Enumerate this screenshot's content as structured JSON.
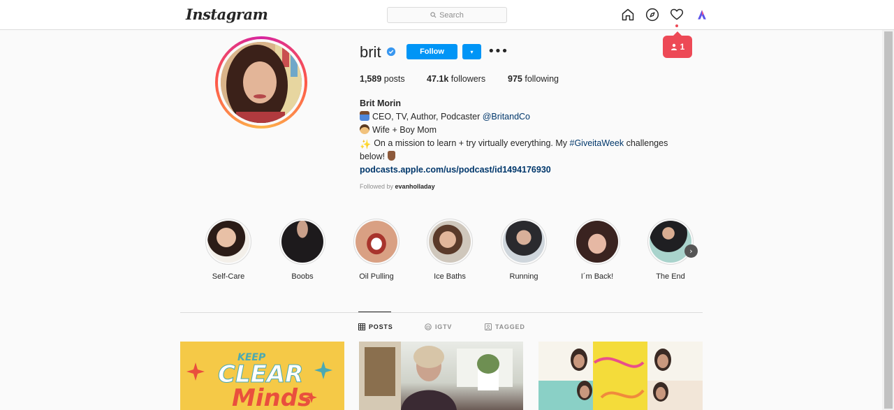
{
  "nav": {
    "logo": "Instagram",
    "search_placeholder": "Search",
    "notification_count": "1"
  },
  "profile": {
    "username": "brit",
    "follow_label": "Follow",
    "dropdown_glyph": "▾",
    "more_glyph": "•••",
    "stats": {
      "posts_count": "1,589",
      "posts_label": "posts",
      "followers_count": "47.1k",
      "followers_label": "followers",
      "following_count": "975",
      "following_label": "following"
    },
    "bio": {
      "name": "Brit Morin",
      "line1_text": "CEO, TV, Author, Podcaster ",
      "line1_mention": "@BritandCo",
      "line2_text": "Wife + Boy Mom",
      "line3_text": "On a mission to learn + try virtually everything. My ",
      "line3_hashtag": "#GiveitaWeek",
      "line3_end": " challenges",
      "line4_text": "below!",
      "url": "podcasts.apple.com/us/podcast/id1494176930"
    },
    "followed_by_prefix": "Followed by",
    "followed_by_user": "evanholladay"
  },
  "highlights": [
    {
      "label": "Self-Care"
    },
    {
      "label": "Boobs"
    },
    {
      "label": "Oil Pulling"
    },
    {
      "label": "Ice Baths"
    },
    {
      "label": "Running"
    },
    {
      "label": "I´m Back!"
    },
    {
      "label": "The End"
    }
  ],
  "tabs": [
    {
      "label": "POSTS",
      "icon": "grid-icon"
    },
    {
      "label": "IGTV",
      "icon": "igtv-icon"
    },
    {
      "label": "TAGGED",
      "icon": "tagged-icon"
    }
  ],
  "posts": {
    "post1_keep": "KEEP",
    "post1_clear": "CLEAR",
    "post1_minds": "Minds"
  },
  "colors": {
    "accent": "#0095f6",
    "notification": "#ed4956",
    "link": "#00376b"
  }
}
